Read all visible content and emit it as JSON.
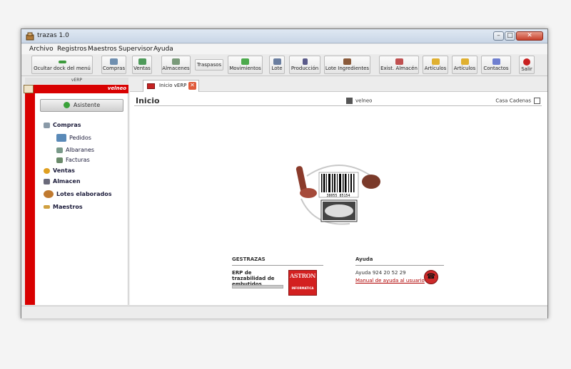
{
  "window": {
    "title": "trazas 1.0",
    "minimize": "–",
    "maximize": "□",
    "close": "✕"
  },
  "menu": [
    "Archivo",
    "Registros",
    "Maestros",
    "Supervisor",
    "Ayuda"
  ],
  "toolbar": [
    {
      "label": "Ocultar dock del menú",
      "icon": "arrow-left-icon"
    },
    {
      "label": "Compras",
      "icon": "cart-icon"
    },
    {
      "label": "Ventas",
      "icon": "sales-icon"
    },
    {
      "label": "Almacenes",
      "icon": "warehouse-icon"
    },
    {
      "label": "Traspasos",
      "icon": ""
    },
    {
      "label": "Movimientos",
      "icon": "grid-icon"
    },
    {
      "label": "Lote",
      "icon": "lot-icon"
    },
    {
      "label": "Producción",
      "icon": "production-icon"
    },
    {
      "label": "Lote Ingredientes",
      "icon": "ingredients-icon"
    },
    {
      "label": "Exist. Almacén",
      "icon": "stock-icon"
    },
    {
      "label": "Artículos",
      "icon": "box-icon"
    },
    {
      "label": "Artículos",
      "icon": "box-icon"
    },
    {
      "label": "Contactos",
      "icon": "contacts-icon"
    },
    {
      "label": "Salir",
      "icon": "exit-icon"
    }
  ],
  "dock": {
    "header": "vERP",
    "brand": "velneo"
  },
  "sidebar": {
    "assistant": "Asistente",
    "items": [
      {
        "label": "Compras",
        "level": 0
      },
      {
        "label": "Pedidos",
        "level": 1
      },
      {
        "label": "Albaranes",
        "level": 1
      },
      {
        "label": "Facturas",
        "level": 1
      },
      {
        "label": "Ventas",
        "level": 0
      },
      {
        "label": "Almacen",
        "level": 0
      },
      {
        "label": "Lotes elaborados",
        "level": 0
      },
      {
        "label": "Maestros",
        "level": 0
      }
    ]
  },
  "tab": {
    "label": "Inicio vERP",
    "close": "✕"
  },
  "page": {
    "title": "Inicio",
    "user": "velneo",
    "company": "Casa Cadenas"
  },
  "logo": {
    "barcode_number": "38055 85154"
  },
  "gestrazas": {
    "heading": "GESTRAZAS",
    "description": "ERP de trazabilidad de embutidos",
    "partner_logo": "ASTRON",
    "partner_sub": "INFORMATICA"
  },
  "ayuda": {
    "heading": "Ayuda",
    "phone_line": "Ayuda  924 20 52 29",
    "manual_link": "Manual de ayuda al usuario",
    "phone_icon": "☎"
  },
  "colors": {
    "accent_red": "#d80000",
    "link": "#b00000"
  }
}
